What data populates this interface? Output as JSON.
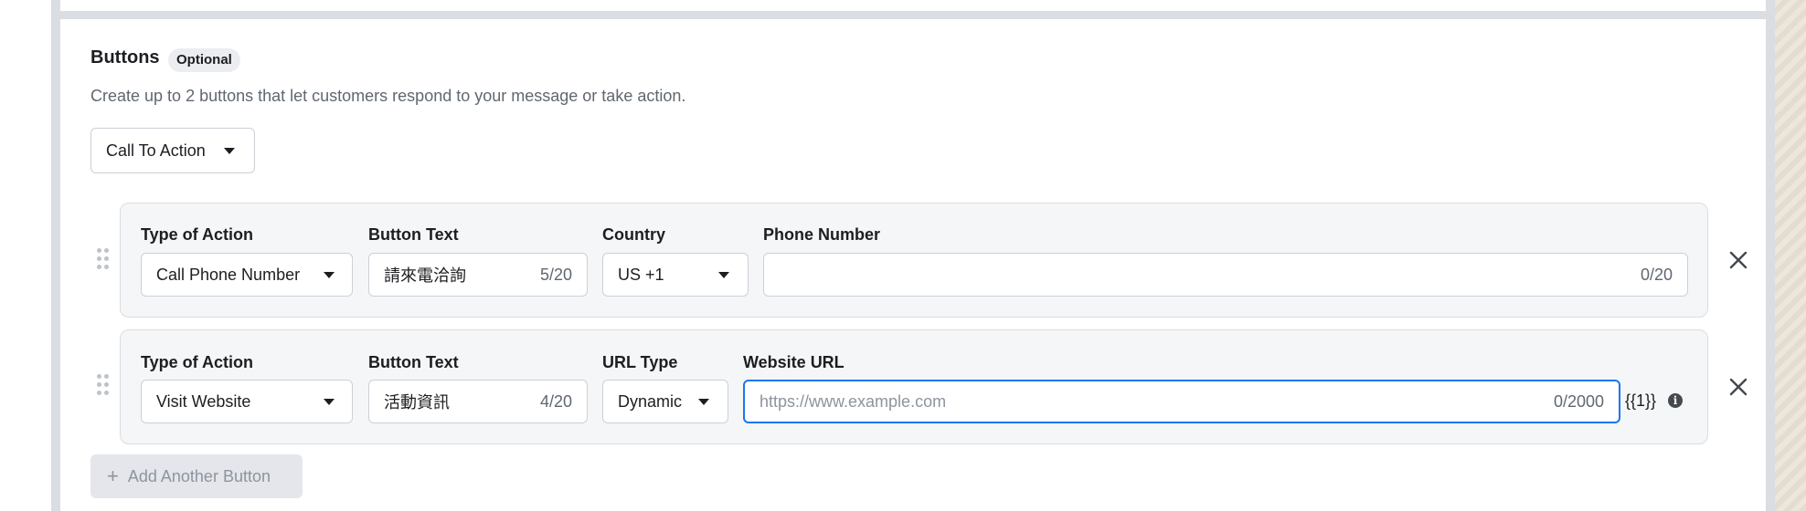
{
  "section": {
    "title": "Buttons",
    "badge": "Optional",
    "description": "Create up to 2 buttons that let customers respond to your message or take action."
  },
  "cta_select": {
    "value": "Call To Action"
  },
  "rows": [
    {
      "type_label": "Type of Action",
      "type_value": "Call Phone Number",
      "text_label": "Button Text",
      "text_value": "請來電洽詢",
      "text_counter": "5/20",
      "third_label": "Country",
      "third_value": "US +1",
      "fourth_label": "Phone Number",
      "fourth_value": "",
      "fourth_counter": "0/20"
    },
    {
      "type_label": "Type of Action",
      "type_value": "Visit Website",
      "text_label": "Button Text",
      "text_value": "活動資訊",
      "text_counter": "4/20",
      "third_label": "URL Type",
      "third_value": "Dynamic",
      "fourth_label": "Website URL",
      "fourth_placeholder": "https://www.example.com",
      "fourth_counter": "0/2000",
      "variable_token": "{{1}}"
    }
  ],
  "add_button": {
    "label": "Add Another Button"
  },
  "icons": {
    "drag": "drag-handle-icon",
    "close": "close-icon",
    "caret": "caret-down-icon",
    "info": "info-icon",
    "plus": "plus-icon"
  },
  "colors": {
    "focus": "#1877f2",
    "border": "#ccd0d5",
    "card_bg": "#f5f6f7"
  }
}
